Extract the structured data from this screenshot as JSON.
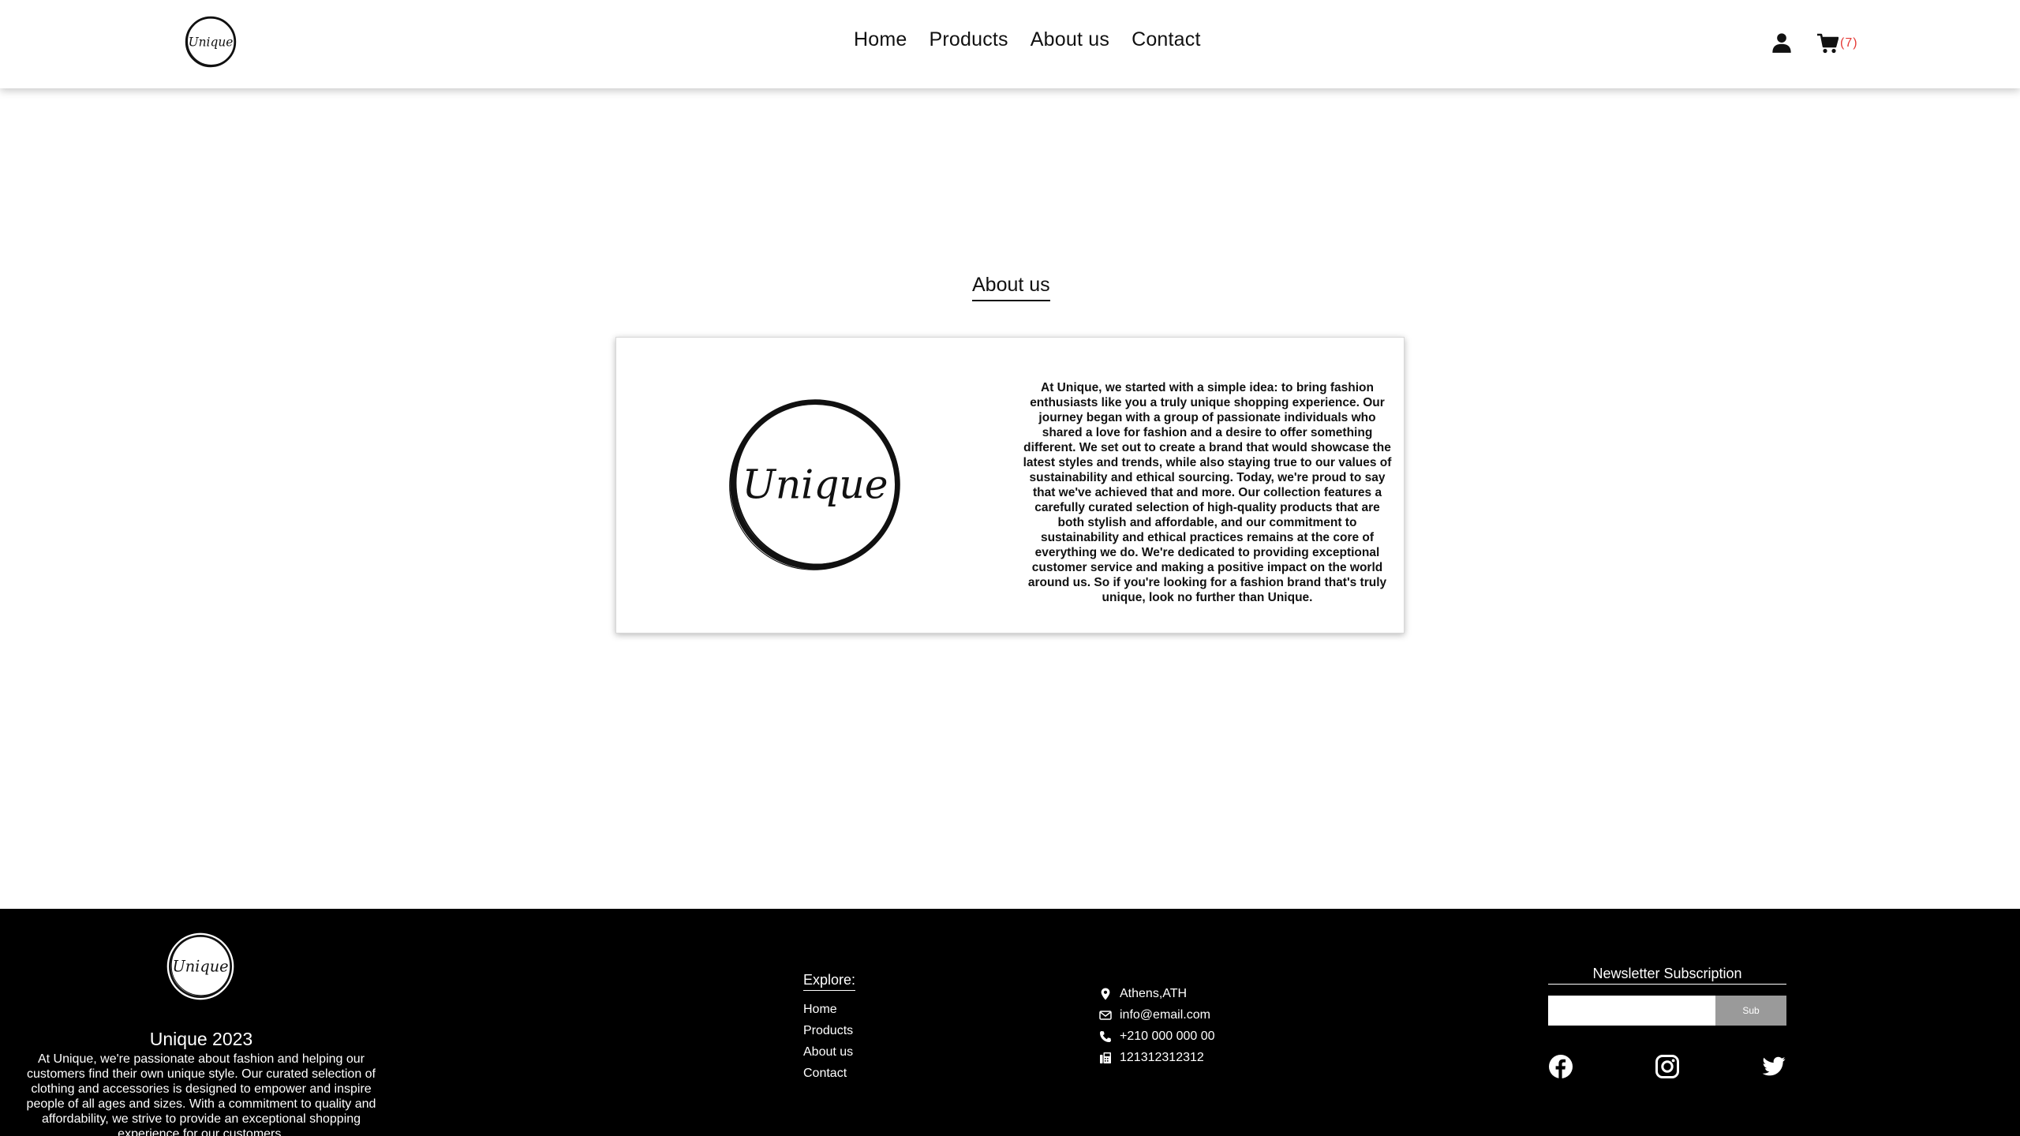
{
  "header": {
    "logo_text": "Unique",
    "nav": [
      "Home",
      "Products",
      "About us",
      "Contact"
    ],
    "cart_count": "(7)"
  },
  "main": {
    "title": "About us",
    "logo_text": "Unique",
    "description": "At Unique, we started with a simple idea: to bring fashion enthusiasts like you a truly unique shopping experience. Our journey began with a group of passionate individuals who shared a love for fashion and a desire to offer something different. We set out to create a brand that would showcase the latest styles and trends, while also staying true to our values of sustainability and ethical sourcing. Today, we're proud to say that we've achieved that and more. Our collection features a carefully curated selection of high-quality products that are both stylish and affordable, and our commitment to sustainability and ethical practices remains at the core of everything we do. We're dedicated to providing exceptional customer service and making a positive impact on the world around us. So if you're looking for a fashion brand that's truly unique, look no further than Unique."
  },
  "footer": {
    "logo_text": "Unique",
    "brand": "Unique 2023",
    "description": "At Unique, we're passionate about fashion and helping our customers find their own unique style. Our curated selection of clothing and accessories is designed to empower and inspire people of all ages and sizes. With a commitment to quality and affordability, we strive to provide an exceptional shopping experience for our customers.",
    "explore_title": "Explore:",
    "explore_links": [
      "Home",
      "Products",
      "About us",
      "Contact"
    ],
    "contact": {
      "location": "Athens,ATH",
      "email": "info@email.com",
      "phone": "+210 000 000 00",
      "fax": "121312312312"
    },
    "newsletter": {
      "title": "Newsletter Subscription",
      "input_value": "",
      "button_label": "Sub"
    },
    "socials": [
      "facebook-icon",
      "instagram-icon",
      "twitter-icon"
    ]
  },
  "colors": {
    "cart_count": "#e53935",
    "footer_bg": "#000000",
    "subscribe_button": "#9a9a9a"
  }
}
